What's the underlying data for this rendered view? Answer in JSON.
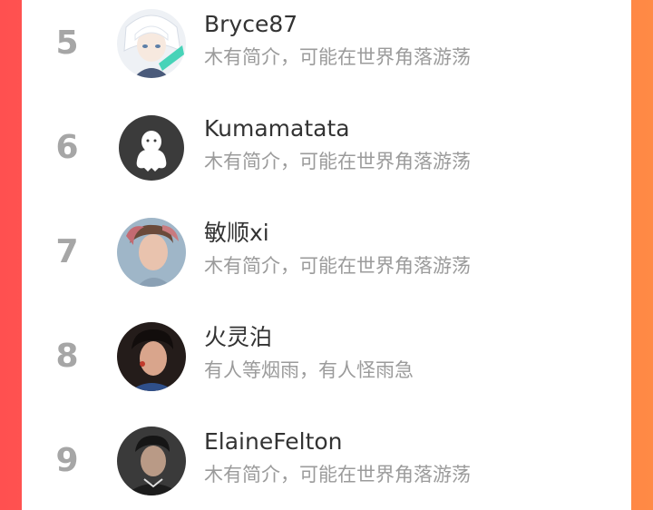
{
  "colors": {
    "background_left": "#ff5050",
    "background_right": "#ff8a45",
    "panel": "#ffffff",
    "rank_text": "#a6a6a6",
    "name_text": "#333333",
    "bio_text": "#9b9b9b"
  },
  "leaderboard": {
    "rows": [
      {
        "rank": "5",
        "name": "Bryce87",
        "bio": "木有简介，可能在世界角落游荡",
        "avatar": "anime-character-avatar"
      },
      {
        "rank": "6",
        "name": "Kumamatata",
        "bio": "木有简介，可能在世界角落游荡",
        "avatar": "default-ghost-avatar"
      },
      {
        "rank": "7",
        "name": "敏顺xi",
        "bio": "木有简介，可能在世界角落游荡",
        "avatar": "photo-avatar"
      },
      {
        "rank": "8",
        "name": "火灵泊",
        "bio": "有人等烟雨，有人怪雨急",
        "avatar": "photo-avatar"
      },
      {
        "rank": "9",
        "name": "ElaineFelton",
        "bio": "木有简介，可能在世界角落游荡",
        "avatar": "photo-avatar"
      }
    ]
  }
}
